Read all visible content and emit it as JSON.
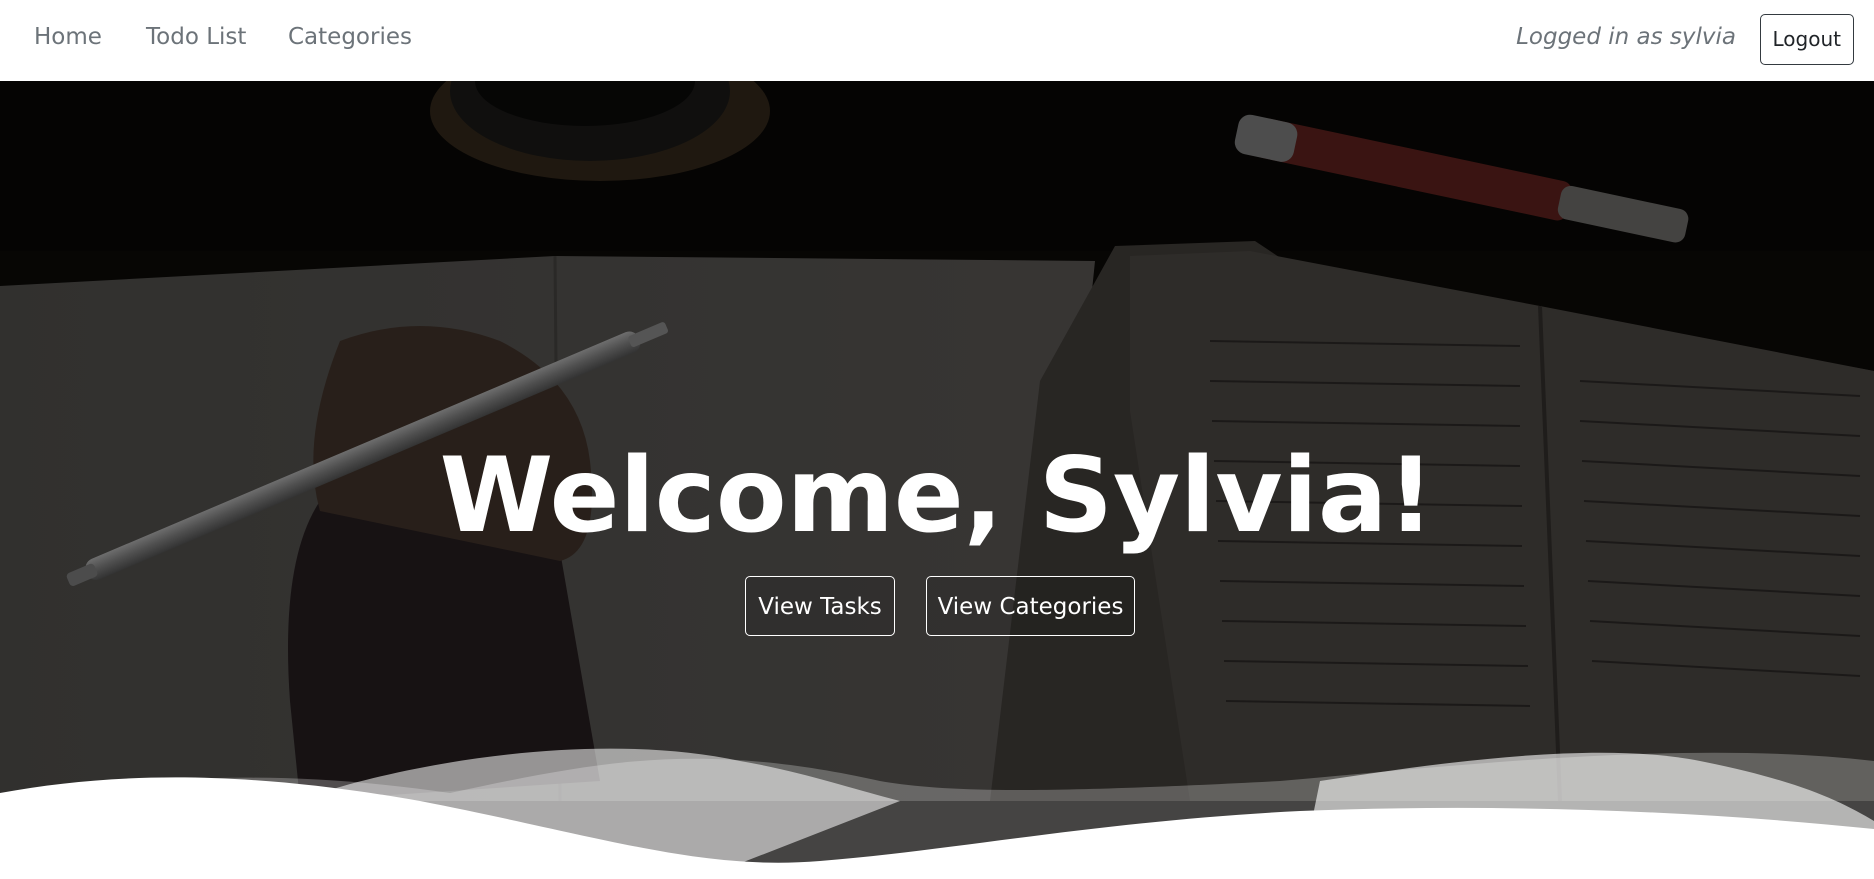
{
  "navbar": {
    "links": [
      {
        "label": "Home"
      },
      {
        "label": "Todo List"
      },
      {
        "label": "Categories"
      }
    ],
    "logged_in_text": "Logged in as sylvia",
    "logout_label": "Logout"
  },
  "hero": {
    "title": "Welcome, Sylvia!",
    "buttons": [
      {
        "label": "View Tasks"
      },
      {
        "label": "View Categories"
      }
    ],
    "background_image": "desk-with-notebook-pen-and-open-book",
    "overlay_color": "#000000"
  },
  "colors": {
    "nav_link": "#6c7379",
    "logout_border": "#343a40",
    "wave": "#ffffff"
  }
}
